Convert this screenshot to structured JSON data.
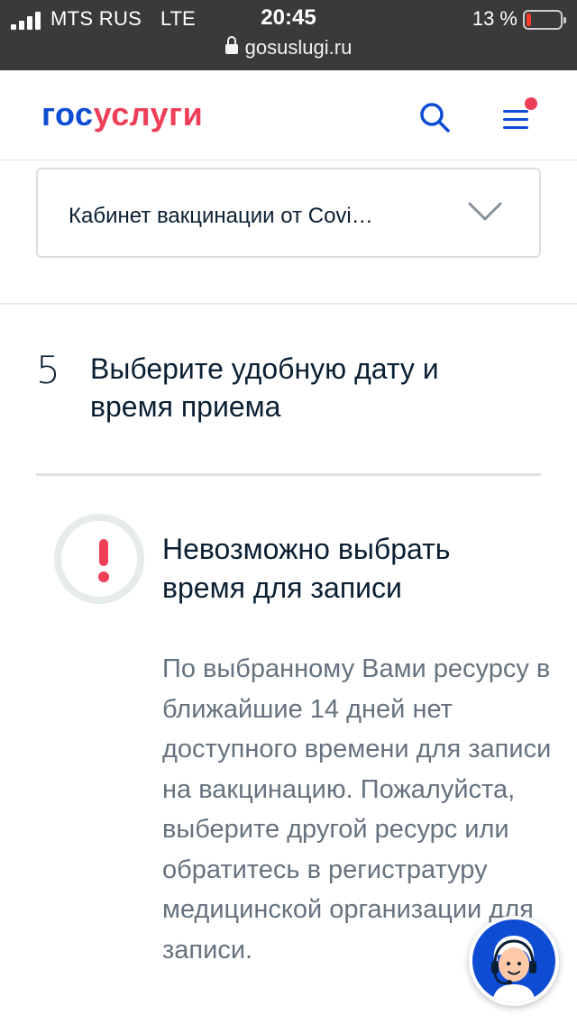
{
  "status_bar": {
    "carrier": "MTS RUS",
    "network": "LTE",
    "time": "20:45",
    "battery_percent_text": "13 %",
    "battery_level": 0.13,
    "url": "gosuslugi.ru",
    "icons": [
      "signal-icon",
      "lock-icon",
      "battery-icon"
    ]
  },
  "header": {
    "logo_part1": "гос",
    "logo_part2": "услуги",
    "icons": [
      "search-icon",
      "menu-icon"
    ],
    "colors": {
      "brand_blue": "#0d4cd3",
      "brand_red": "#ee3f58"
    }
  },
  "select": {
    "value": "Кабинет вакцинации от Covi…",
    "icon": "chevron-down-icon"
  },
  "step": {
    "number": "5",
    "title": "Выберите удобную дату и время приема"
  },
  "alert": {
    "icon": "exclamation-icon",
    "title": "Невозможно выбрать время для записи",
    "text": "По выбранному Вами ресурсу в ближайшие 14 дней нет доступного времени для записи на вакцинацию. Пожалуйста, выберите другой ресурс или обратитесь в регистратуру медицинской организации для записи."
  },
  "support": {
    "icon": "support-operator-icon"
  }
}
